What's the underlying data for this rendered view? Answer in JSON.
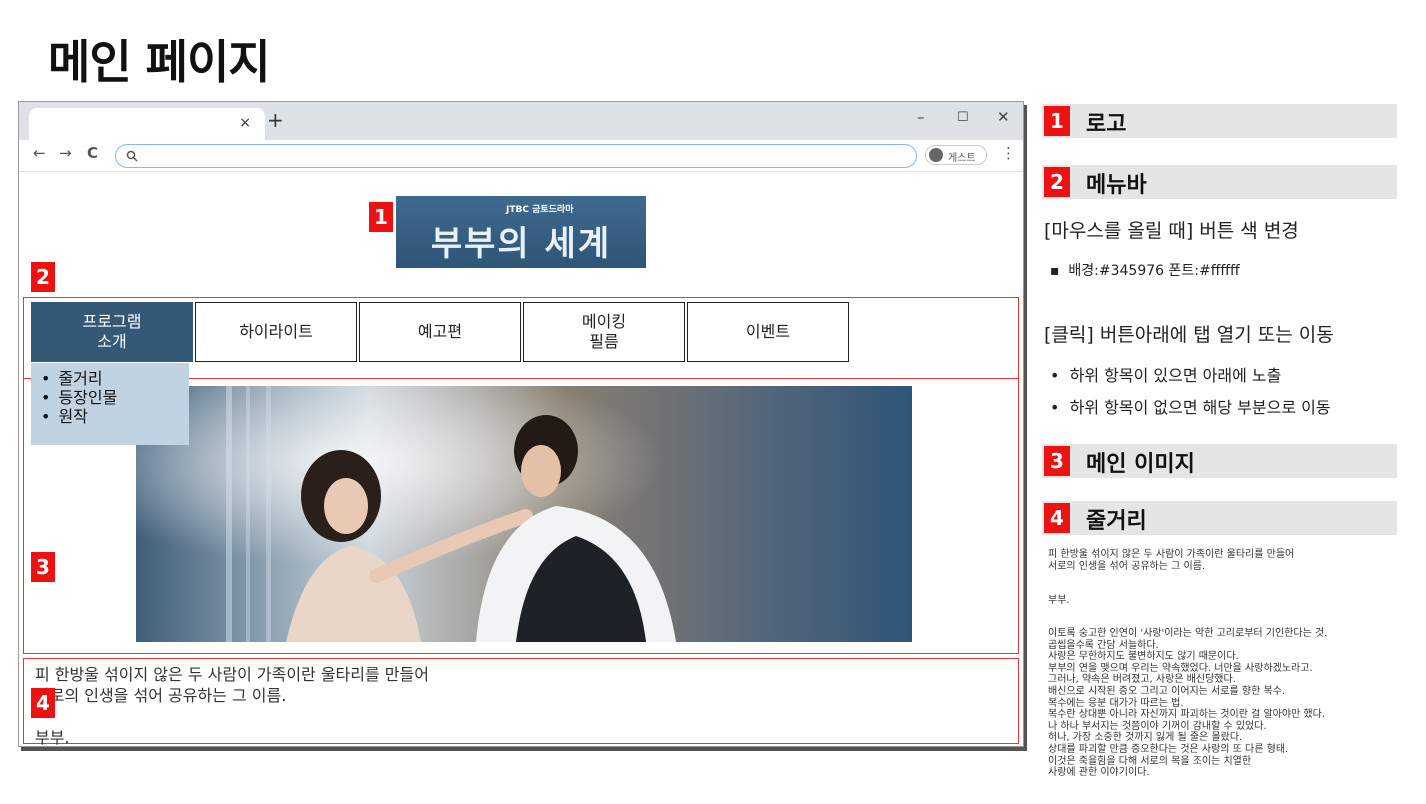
{
  "page_title": "메인 페이지",
  "browser": {
    "tab_close": "×",
    "new_tab": "+",
    "minimize": "–",
    "maximize": "☐",
    "close": "✕",
    "back": "←",
    "forward": "→",
    "reload": "C",
    "search_icon": "🔍",
    "profile_label": "게스트",
    "menu": "⋮"
  },
  "site": {
    "logo": {
      "sub": "JTBC 금토드라마",
      "title": "부부의 세계"
    },
    "menu": [
      {
        "label": "프로그램\n소개",
        "active": true
      },
      {
        "label": "하이라이트"
      },
      {
        "label": "예고편"
      },
      {
        "label": "메이킹\n필름"
      },
      {
        "label": "이벤트"
      }
    ],
    "submenu": [
      "줄거리",
      "등장인물",
      "원작"
    ],
    "synopsis": {
      "line1": "피 한방울 섞이지 않은 두 사람이 가족이란 울타리를 만들어",
      "line2": "서로의 인생을 섞어 공유하는 그 이름.",
      "line3": "부부."
    }
  },
  "markers": [
    "1",
    "2",
    "3",
    "4"
  ],
  "annotations": {
    "logo": {
      "num": "1",
      "title": "로고"
    },
    "menubar": {
      "num": "2",
      "title": "메뉴바",
      "hover_heading": "[마우스를 올릴 때] 버튼 색 변경",
      "hover_detail": "배경:#345976 폰트:#ffffff",
      "click_heading": "[클릭] 버튼아래에 탭 열기 또는 이동",
      "click_items": [
        "하위 항목이 있으면 아래에 노출",
        "하위 항목이 없으면 해당 부분으로 이동"
      ]
    },
    "main_image": {
      "num": "3",
      "title": "메인 이미지"
    },
    "synopsis": {
      "num": "4",
      "title": "줄거리",
      "paragraph1": "피 한방울 섞이지 않은 두 사람이 가족이란 울타리를 만들어\n서로의 인생을 섞어 공유하는 그 이름.",
      "paragraph2": "부부.",
      "paragraph3": "이토록 숭고한 인연이 '사랑'이라는 악한 고리로부터 기인한다는 것.\n곱씹을수록 간담 서늘하다.\n사랑은 무한하지도 불변하지도 않기 때문이다.\n부부의 연을 맺으며 우리는 약속했었다. 너만을 사랑하겠노라고.\n그러나, 약속은 버려졌고, 사랑은 배신당했다.\n배신으로 시작된 증오 그리고 이어지는 서로를 향한 복수.\n복수에는 응분 대가가 따르는 법.\n복수란 상대뿐 아니라 자신까지 파괴하는 것이란 걸 알아야만 했다.\n나 하나 부서지는 것쯤이야 기꺼이 감내할 수 있었다.\n허나, 가장 소중한 것까지 잃게 될 줄은 몰랐다.\n상대를 파괴할 만큼 증오한다는 것은 사랑의 또 다른 형태.\n이것은 죽을힘을 다해 서로의 목을 조이는 치열한\n사랑에 관한 이야기이다."
    }
  },
  "colors": {
    "accent": "#345976",
    "marker": "#ee1111",
    "submenu_bg": "#c0d3e3"
  }
}
